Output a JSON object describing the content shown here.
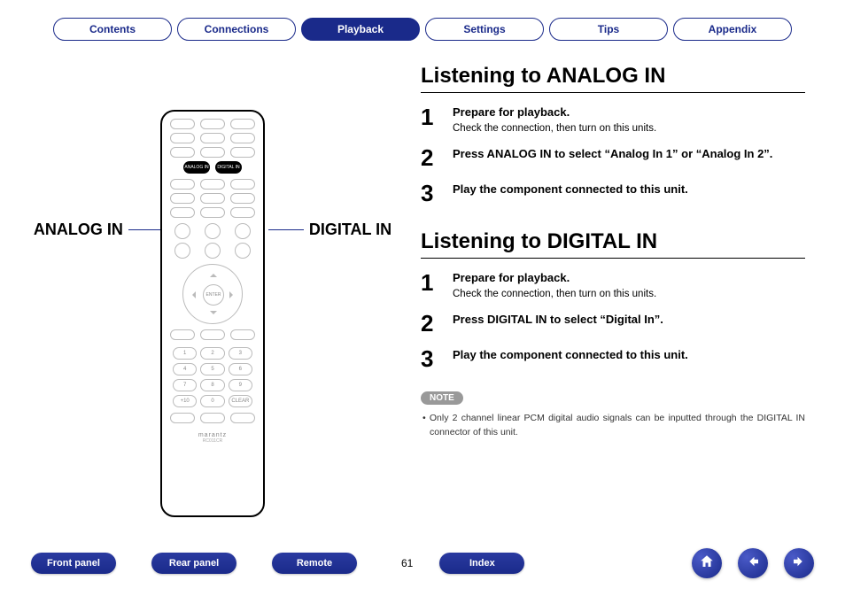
{
  "tabs": {
    "contents": "Contents",
    "connections": "Connections",
    "playback": "Playback",
    "settings": "Settings",
    "tips": "Tips",
    "appendix": "Appendix",
    "activeIndex": 2
  },
  "leftPanel": {
    "analogLabel": "ANALOG IN",
    "digitalLabel": "DIGITAL IN",
    "remote": {
      "highlightButtons": [
        "ANALOG IN",
        "DIGITAL IN"
      ],
      "enterLabel": "ENTER",
      "numpad": [
        "1",
        "2",
        "3",
        "4",
        "5",
        "6",
        "7",
        "8",
        "9",
        "+10",
        "0",
        "CLEAR"
      ],
      "brand": "marantz",
      "model": "RC011CR"
    }
  },
  "sections": [
    {
      "heading": "Listening to ANALOG IN",
      "steps": [
        {
          "n": "1",
          "bold": "Prepare for playback.",
          "sub": "Check the connection, then turn on this units."
        },
        {
          "n": "2",
          "bold": "Press ANALOG IN to select “Analog In 1” or “Analog In 2”."
        },
        {
          "n": "3",
          "bold": "Play the component connected to this unit."
        }
      ]
    },
    {
      "heading": "Listening to DIGITAL IN",
      "steps": [
        {
          "n": "1",
          "bold": "Prepare for playback.",
          "sub": "Check the connection, then turn on this units."
        },
        {
          "n": "2",
          "bold": "Press DIGITAL IN to select “Digital In”."
        },
        {
          "n": "3",
          "bold": "Play the component connected to this unit."
        }
      ],
      "noteLabel": "NOTE",
      "noteText": "• Only 2 channel linear PCM digital audio signals can be inputted through the DIGITAL IN connector of this unit."
    }
  ],
  "bottomNav": {
    "buttons": [
      "Front panel",
      "Rear panel",
      "Remote"
    ],
    "page": "61",
    "indexLabel": "Index"
  }
}
